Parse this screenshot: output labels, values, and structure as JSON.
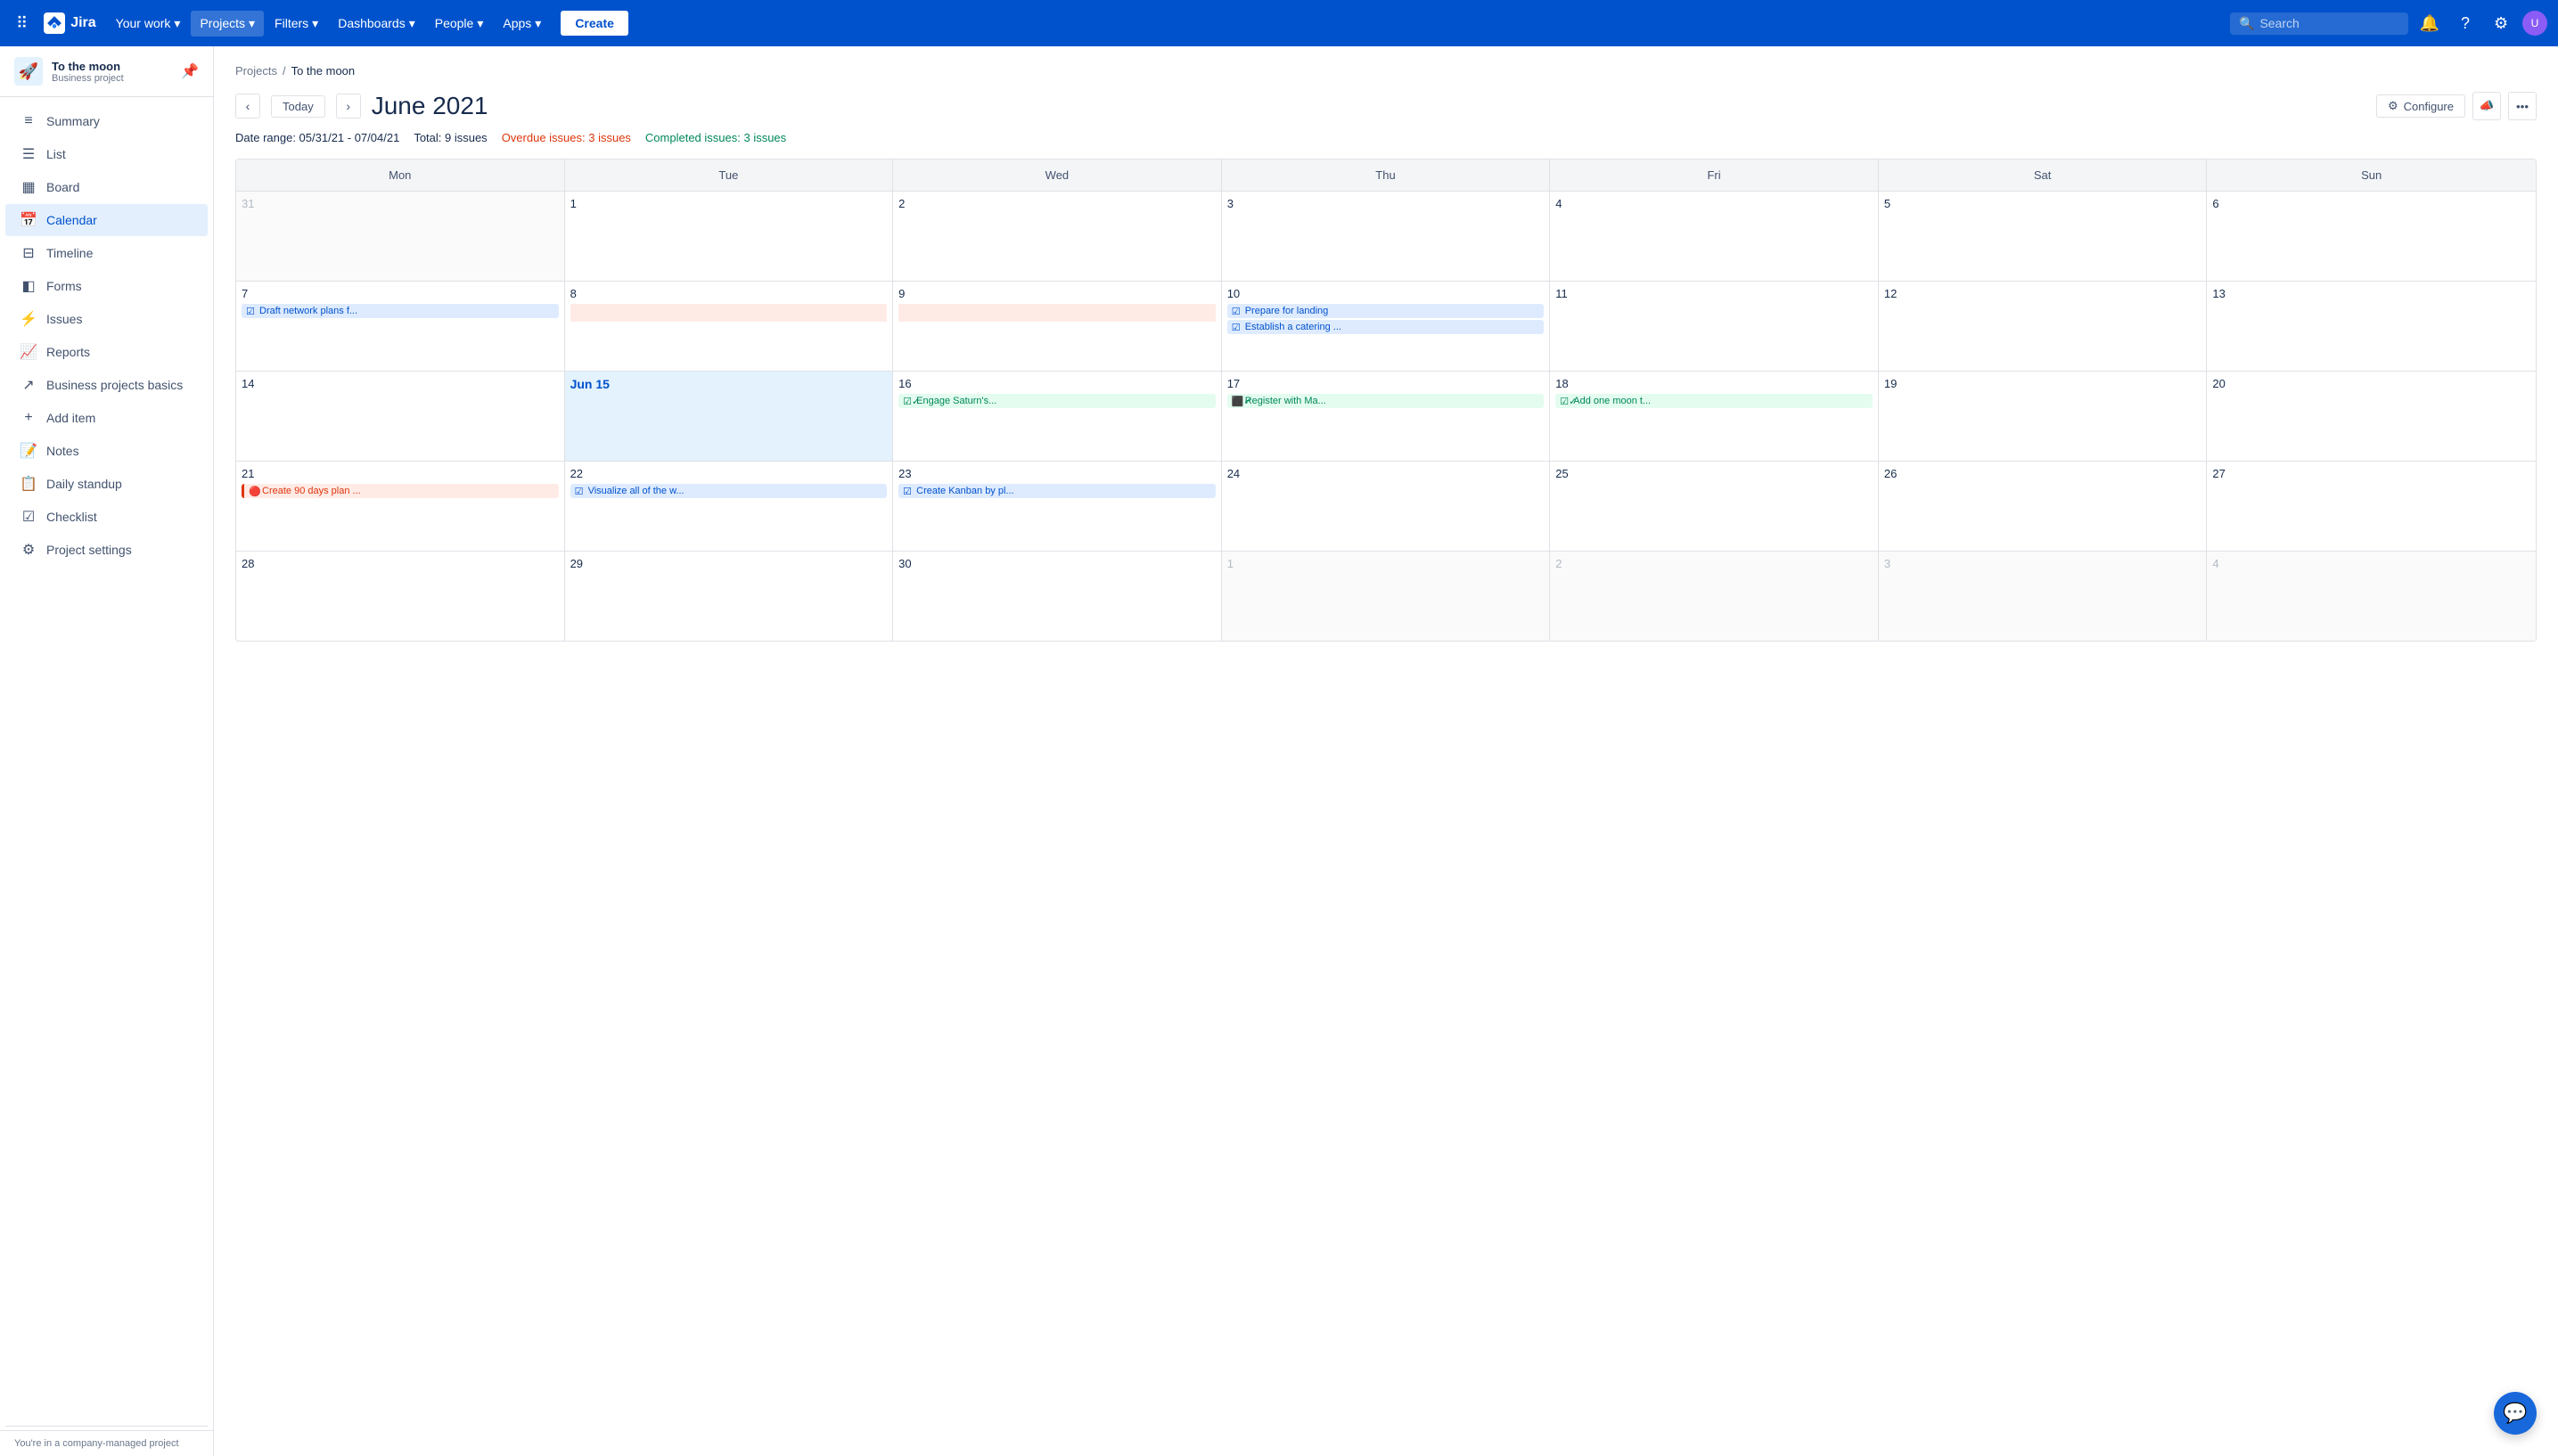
{
  "topnav": {
    "logo_text": "Jira",
    "your_work": "Your work",
    "projects": "Projects",
    "filters": "Filters",
    "dashboards": "Dashboards",
    "people": "People",
    "apps": "Apps",
    "create": "Create",
    "search_placeholder": "Search"
  },
  "sidebar": {
    "project_name": "To the moon",
    "project_type": "Business project",
    "nav_items": [
      {
        "id": "summary",
        "label": "Summary",
        "icon": "≡"
      },
      {
        "id": "list",
        "label": "List",
        "icon": "☰"
      },
      {
        "id": "board",
        "label": "Board",
        "icon": "▦"
      },
      {
        "id": "calendar",
        "label": "Calendar",
        "icon": "📅",
        "active": true
      },
      {
        "id": "timeline",
        "label": "Timeline",
        "icon": "⊟"
      },
      {
        "id": "forms",
        "label": "Forms",
        "icon": "◧"
      },
      {
        "id": "issues",
        "label": "Issues",
        "icon": "⚡"
      },
      {
        "id": "reports",
        "label": "Reports",
        "icon": "📈"
      },
      {
        "id": "business-basics",
        "label": "Business projects basics",
        "icon": "↗"
      },
      {
        "id": "add-item",
        "label": "Add item",
        "icon": "+"
      },
      {
        "id": "notes",
        "label": "Notes",
        "icon": "📝"
      },
      {
        "id": "daily-standup",
        "label": "Daily standup",
        "icon": "📋"
      },
      {
        "id": "checklist",
        "label": "Checklist",
        "icon": "☑"
      },
      {
        "id": "project-settings",
        "label": "Project settings",
        "icon": "⚙"
      }
    ],
    "footer_text": "You're in a company-managed project"
  },
  "breadcrumb": {
    "projects_label": "Projects",
    "current_label": "To the moon"
  },
  "calendar": {
    "prev_label": "‹",
    "next_label": "›",
    "today_label": "Today",
    "month_title": "June 2021",
    "configure_label": "Configure",
    "date_range_label": "Date range: 05/31/21 - 07/04/21",
    "total_label": "Total: 9 issues",
    "overdue_label": "Overdue issues: 3 issues",
    "completed_label": "Completed issues: 3 issues",
    "day_headers": [
      "Mon",
      "Tue",
      "Wed",
      "Thu",
      "Fri",
      "Sat",
      "Sun"
    ],
    "weeks": [
      {
        "days": [
          {
            "num": "31",
            "other": true,
            "today": false,
            "events": []
          },
          {
            "num": "1",
            "other": false,
            "today": false,
            "events": []
          },
          {
            "num": "2",
            "other": false,
            "today": false,
            "events": []
          },
          {
            "num": "3",
            "other": false,
            "today": false,
            "events": []
          },
          {
            "num": "4",
            "other": false,
            "today": false,
            "events": []
          },
          {
            "num": "5",
            "other": false,
            "today": false,
            "events": []
          },
          {
            "num": "6",
            "other": false,
            "today": false,
            "events": []
          }
        ]
      },
      {
        "days": [
          {
            "num": "7",
            "other": false,
            "today": false,
            "events": [
              {
                "type": "blue",
                "text": "Draft network plans f...",
                "icon": "☑",
                "spanning": true
              }
            ]
          },
          {
            "num": "8",
            "other": false,
            "today": false,
            "events": [
              {
                "type": "spanning-cont",
                "text": "",
                "spanning": true
              }
            ]
          },
          {
            "num": "9",
            "other": false,
            "today": false,
            "events": [
              {
                "type": "spanning-cont",
                "text": "",
                "spanning": true
              }
            ]
          },
          {
            "num": "10",
            "other": false,
            "today": false,
            "events": [
              {
                "type": "blue",
                "text": "Prepare for landing",
                "icon": "☑"
              },
              {
                "type": "blue",
                "text": "Establish a catering ...",
                "icon": "☑"
              }
            ]
          },
          {
            "num": "11",
            "other": false,
            "today": false,
            "events": []
          },
          {
            "num": "12",
            "other": false,
            "today": false,
            "events": []
          },
          {
            "num": "13",
            "other": false,
            "today": false,
            "events": []
          }
        ]
      },
      {
        "days": [
          {
            "num": "14",
            "other": false,
            "today": false,
            "events": []
          },
          {
            "num": "Jun 15",
            "other": false,
            "today": true,
            "events": []
          },
          {
            "num": "16",
            "other": false,
            "today": false,
            "events": [
              {
                "type": "green",
                "text": "Engage Saturn's...",
                "icon": "☑✓"
              }
            ]
          },
          {
            "num": "17",
            "other": false,
            "today": false,
            "events": [
              {
                "type": "green",
                "text": "Register with Ma...",
                "icon": "⬛✓"
              }
            ]
          },
          {
            "num": "18",
            "other": false,
            "today": false,
            "events": [
              {
                "type": "green",
                "text": "Add one moon t...",
                "icon": "☑✓"
              }
            ]
          },
          {
            "num": "19",
            "other": false,
            "today": false,
            "events": []
          },
          {
            "num": "20",
            "other": false,
            "today": false,
            "events": []
          }
        ]
      },
      {
        "days": [
          {
            "num": "21",
            "other": false,
            "today": false,
            "events": [
              {
                "type": "red-outline",
                "text": "Create 90 days plan ...",
                "icon": "🔴"
              }
            ]
          },
          {
            "num": "22",
            "other": false,
            "today": false,
            "events": [
              {
                "type": "blue",
                "text": "Visualize all of the w...",
                "icon": "☑"
              }
            ]
          },
          {
            "num": "23",
            "other": false,
            "today": false,
            "events": [
              {
                "type": "blue",
                "text": "Create Kanban by pl...",
                "icon": "☑"
              }
            ]
          },
          {
            "num": "24",
            "other": false,
            "today": false,
            "events": []
          },
          {
            "num": "25",
            "other": false,
            "today": false,
            "events": []
          },
          {
            "num": "26",
            "other": false,
            "today": false,
            "events": []
          },
          {
            "num": "27",
            "other": false,
            "today": false,
            "events": []
          }
        ]
      },
      {
        "days": [
          {
            "num": "28",
            "other": false,
            "today": false,
            "events": []
          },
          {
            "num": "29",
            "other": false,
            "today": false,
            "events": []
          },
          {
            "num": "30",
            "other": false,
            "today": false,
            "events": []
          },
          {
            "num": "1",
            "other": true,
            "today": false,
            "events": []
          },
          {
            "num": "2",
            "other": true,
            "today": false,
            "events": []
          },
          {
            "num": "3",
            "other": true,
            "today": false,
            "events": []
          },
          {
            "num": "4",
            "other": true,
            "today": false,
            "events": []
          }
        ]
      }
    ]
  }
}
